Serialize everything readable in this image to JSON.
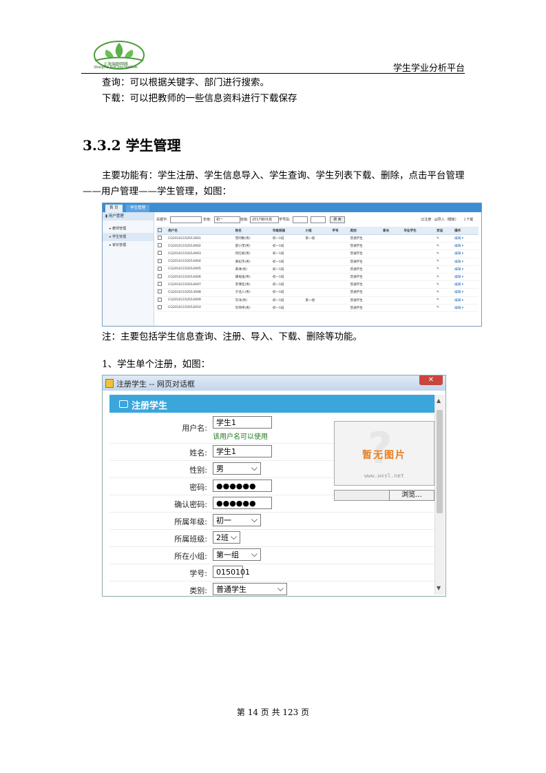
{
  "header": {
    "logo_cn": "上海瑞聪网络",
    "logo_en": "ShangHai RuiCong NetWork",
    "platform_title": "学生学业分析平台"
  },
  "body": {
    "line1": "查询：可以根据关键字、部门进行搜索。",
    "line2": "下载：可以把教师的一些信息资料进行下载保存",
    "heading": "3.3.2  学生管理",
    "desc": "主要功能有：学生注册、学生信息导入、学生查询、学生列表下载、删除，点击平台管理——用户管理——学生管理，如图：",
    "note": "注：主要包括学生信息查询、注册、导入、下载、删除等功能。",
    "item1": "1、学生单个注册，如图："
  },
  "screenshot1": {
    "tabs": [
      "首 页",
      "学生管理"
    ],
    "sidebar_title": "用户管理",
    "sidebar_items": [
      "教师管理",
      "学生管理",
      "家长管理"
    ],
    "toolbar": {
      "keyword_label": "关键字:",
      "grade_label": "年级:",
      "grade_value": "初一",
      "class_label": "班级:",
      "class_value": "2017级01班",
      "studentno_label": "学号段:",
      "search_btn": "搜 索",
      "register_btn": "注册",
      "import_btn": "导入（模板）",
      "download_btn": "下载"
    },
    "columns": [
      "",
      "用户名",
      "姓名",
      "年级班级",
      "小组",
      "学号",
      "类别",
      "家长",
      "毕业学生",
      "状态",
      "操作"
    ],
    "rows": [
      [
        "CG20141152013001",
        "曾同敏(男)",
        "初一1班",
        "第一组",
        "",
        "普通学生",
        "",
        "",
        "",
        "编辑 ▾"
      ],
      [
        "CG20141152014002",
        "邵小茂(男)",
        "初一1班",
        "",
        "",
        "普通学生",
        "",
        "",
        "",
        "编辑 ▾"
      ],
      [
        "CG20141152014003",
        "何红娟(男)",
        "初一1班",
        "",
        "",
        "普通学生",
        "",
        "",
        "",
        "编辑 ▾"
      ],
      [
        "CG20141152014004",
        "黄纪杰(男)",
        "初一1班",
        "",
        "",
        "普通学生",
        "",
        "",
        "",
        "编辑 ▾"
      ],
      [
        "CG20141152014005",
        "黄淋(男)",
        "初一1班",
        "",
        "",
        "普通学生",
        "",
        "",
        "",
        "编辑 ▾"
      ],
      [
        "CG20141152014006",
        "康福强(男)",
        "初一1班",
        "",
        "",
        "普通学生",
        "",
        "",
        "",
        "编辑 ▾"
      ],
      [
        "CG20141152014007",
        "李博廷(男)",
        "初一1班",
        "",
        "",
        "普通学生",
        "",
        "",
        "",
        "编辑 ▾"
      ],
      [
        "CG20141152013008",
        "于浩入(男)",
        "初一1班",
        "",
        "",
        "普通学生",
        "",
        "",
        "",
        "编辑 ▾"
      ],
      [
        "CG20141152014009",
        "刘洋(男)",
        "初一1班",
        "第一组",
        "",
        "普通学生",
        "",
        "",
        "",
        "编辑 ▾"
      ],
      [
        "CG20141152014010",
        "刘伟伟(男)",
        "初一1班",
        "",
        "",
        "普通学生",
        "",
        "",
        "",
        "编辑 ▾"
      ]
    ]
  },
  "dialog": {
    "window_title": "注册学生 -- 网页对话框",
    "close": "✕",
    "header": "注册学生",
    "username_label": "用户名:",
    "username_value": "学生1",
    "username_hint": "该用户名可以使用",
    "name_label": "姓名:",
    "name_value": "学生1",
    "gender_label": "性别:",
    "gender_value": "男",
    "password_label": "密码:",
    "password_value": "●●●●●●",
    "confirm_label": "确认密码:",
    "confirm_value": "●●●●●●",
    "grade_label": "所属年级:",
    "grade_value": "初一",
    "class_label": "所属班级:",
    "class_value": "2班",
    "group_label": "所在小组:",
    "group_value": "第一组",
    "studentno_label": "学号:",
    "studentno_value": "0150101",
    "category_label": "类别:",
    "category_value": "普通学生",
    "photo_text": "暂无图片",
    "photo_watermark": "www.wxsl.net",
    "browse_btn": "浏览..."
  },
  "footer": {
    "page": "第 14 页 共 123 页"
  }
}
